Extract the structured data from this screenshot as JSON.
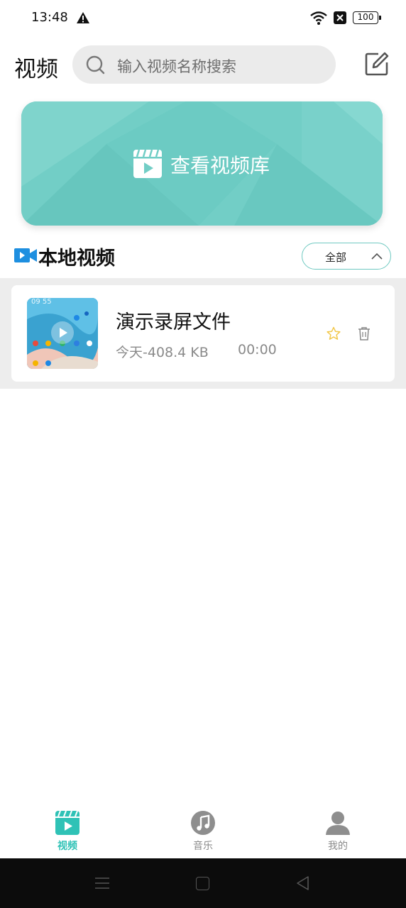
{
  "status_bar": {
    "time": "13:48",
    "battery": "100"
  },
  "header": {
    "title": "视频",
    "search_placeholder": "输入视频名称搜索"
  },
  "banner": {
    "label": "查看视频库",
    "color": "#72cec6"
  },
  "section": {
    "title": "本地视频",
    "filter_label": "全部"
  },
  "videos": [
    {
      "title": "演示录屏文件",
      "meta": "今天-408.4 KB",
      "duration": "00:00",
      "thumb_time": "09 55"
    }
  ],
  "bottom_nav": {
    "items": [
      {
        "label": "视频",
        "icon": "video-clapper-icon",
        "active": true
      },
      {
        "label": "音乐",
        "icon": "music-note-icon",
        "active": false
      },
      {
        "label": "我的",
        "icon": "person-icon",
        "active": false
      }
    ]
  },
  "colors": {
    "accent": "#2fc2b6",
    "video_icon_blue": "#1e8fe0",
    "star": "#f2c84b"
  }
}
